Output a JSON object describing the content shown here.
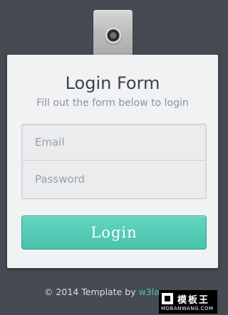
{
  "clip": {
    "icon": "clip-icon"
  },
  "form": {
    "title": "Login Form",
    "subtitle": "Fill out the form below to login",
    "email_placeholder": "Email",
    "password_placeholder": "Password",
    "login_label": "Login"
  },
  "footer": {
    "prefix": "© 2014 Template by ",
    "link": "w3la"
  },
  "watermark": {
    "cn": "模板王",
    "en": "MOBANWANG.COM"
  },
  "colors": {
    "background": "#464b53",
    "card": "#f1f2f4",
    "button": "#4cc8b1",
    "link": "#4cc1ad"
  }
}
